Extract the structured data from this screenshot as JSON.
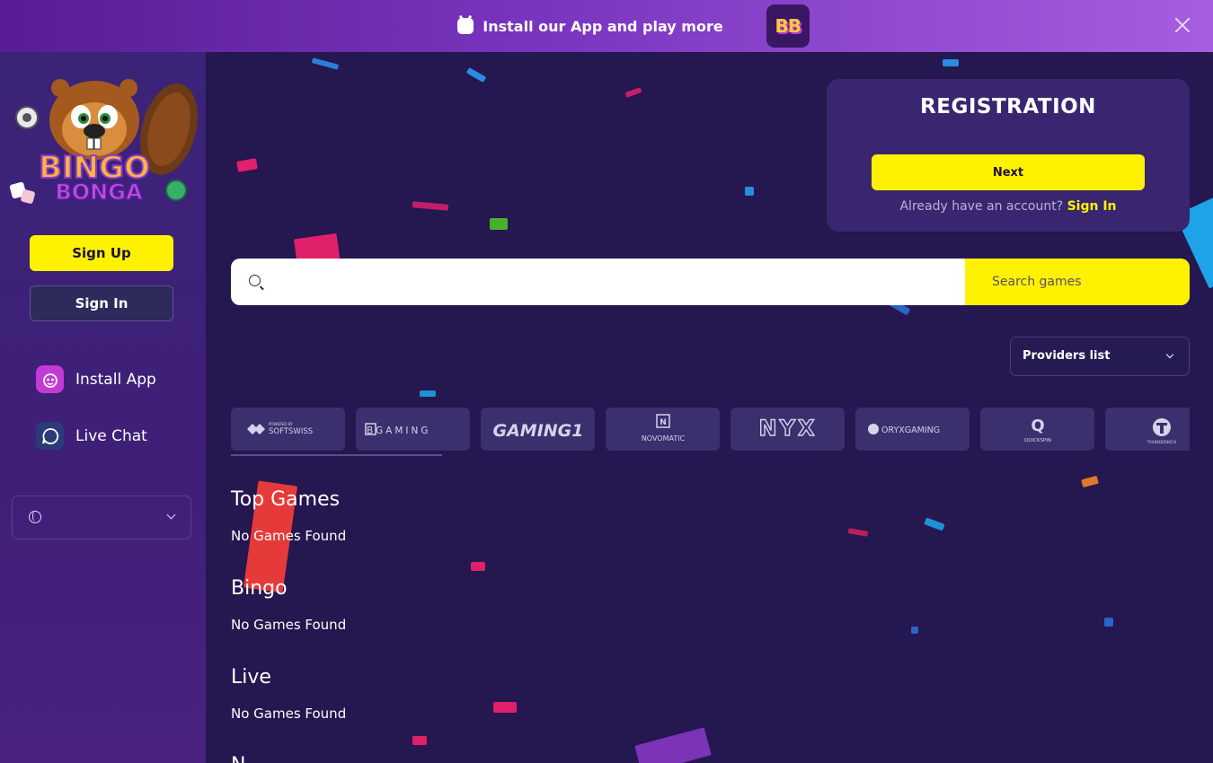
{
  "banner": {
    "text": "Install our App and play more",
    "app_icon_text": "BB"
  },
  "sidebar": {
    "logo_text": "BINGO BONGA",
    "signup_label": "Sign Up",
    "signin_label": "Sign In",
    "links": [
      {
        "label": "Install App",
        "icon": "install-app-icon"
      },
      {
        "label": "Live Chat",
        "icon": "chat-icon"
      }
    ],
    "language_icon": "globe-icon"
  },
  "registration": {
    "title": "REGISTRATION",
    "next_label": "Next",
    "already_text": "Already have an account?",
    "signin_link": "Sign In"
  },
  "search": {
    "placeholder": "",
    "button_label": "Search games"
  },
  "providers": {
    "select_label": "Providers list",
    "items": [
      "SOFTSWISS",
      "BGAMING",
      "GAMING1",
      "NOVOMATIC",
      "NYX",
      "ORYXGAMING",
      "QUICKSPIN",
      "THUNDERKICK"
    ],
    "powered_by": "POWERED BY"
  },
  "sections": [
    {
      "title": "Top Games",
      "empty": "No Games Found"
    },
    {
      "title": "Bingo",
      "empty": "No Games Found"
    },
    {
      "title": "Live",
      "empty": "No Games Found"
    },
    {
      "title": "N",
      "empty": ""
    }
  ],
  "colors": {
    "background": "#25174f",
    "sidebar": "#3b2478",
    "accent_yellow": "#fff200",
    "card": "#3a2670",
    "tile": "#3b2f6e"
  }
}
